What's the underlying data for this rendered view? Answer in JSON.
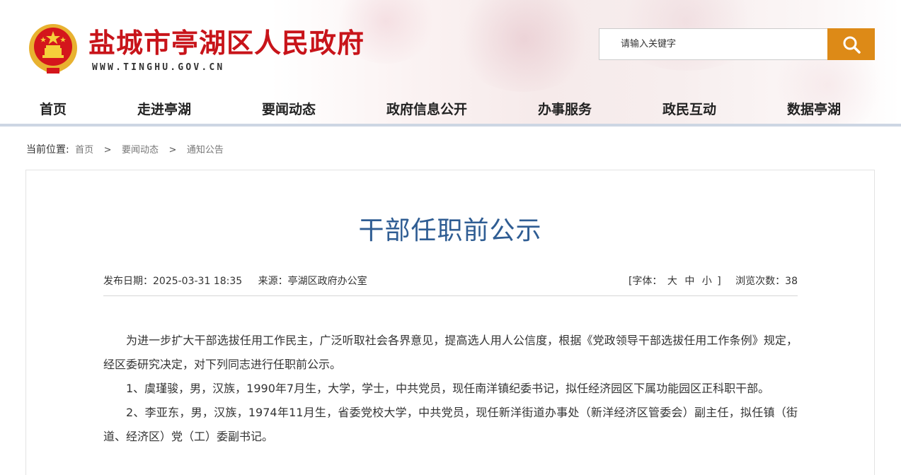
{
  "header": {
    "site_title": "盐城市亭湖区人民政府",
    "site_url": "WWW.TINGHU.GOV.CN",
    "emblem_icon": "national-emblem-icon",
    "search": {
      "placeholder": "请输入关键字",
      "button_icon": "search-icon",
      "button_color": "#dd8a17"
    }
  },
  "nav": {
    "items": [
      {
        "label": "首页"
      },
      {
        "label": "走进亭湖"
      },
      {
        "label": "要闻动态"
      },
      {
        "label": "政府信息公开"
      },
      {
        "label": "办事服务"
      },
      {
        "label": "政民互动"
      },
      {
        "label": "数据亭湖"
      }
    ]
  },
  "breadcrumb": {
    "prefix": "当前位置:",
    "items": [
      "首页",
      "要闻动态",
      "通知公告"
    ],
    "separator": ">"
  },
  "article": {
    "title": "干部任职前公示",
    "meta": {
      "publish_date": "发布日期：2025-03-31 18:35",
      "source": "来源：亭湖区政府办公室",
      "font_size_label": "[字体：",
      "font_size_options": [
        "大",
        "中",
        "小"
      ],
      "font_size_close": "]",
      "views": "浏览次数：38"
    },
    "paragraphs": [
      "为进一步扩大干部选拔任用工作民主，广泛听取社会各界意见，提高选人用人公信度，根据《党政领导干部选拔任用工作条例》规定，经区委研究决定，对下列同志进行任职前公示。",
      "1、虞瑾骏，男，汉族，1990年7月生，大学，学士，中共党员，现任南洋镇纪委书记，拟任经济园区下属功能园区正科职干部。",
      "2、李亚东，男，汉族，1974年11月生，省委党校大学，中共党员，现任新洋街道办事处（新洋经济区管委会）副主任，拟任镇（街道、经济区）党（工）委副书记。"
    ]
  },
  "colors": {
    "title_red": "#c8141a",
    "article_title_blue": "#2f5d93",
    "nav_underline": "#cdd6e3"
  }
}
